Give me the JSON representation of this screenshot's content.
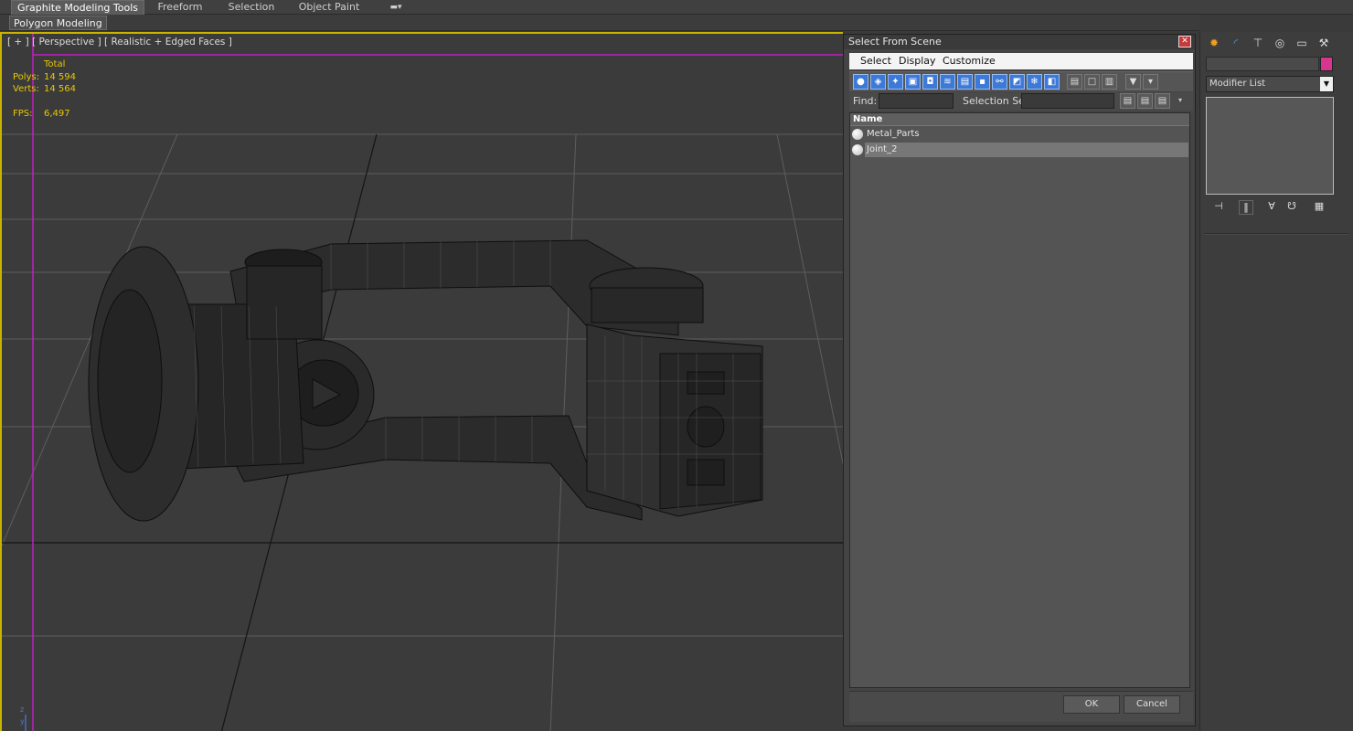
{
  "ribbon": {
    "tabs": [
      "Graphite Modeling Tools",
      "Freeform",
      "Selection",
      "Object Paint"
    ],
    "extra_icon": "ribbon-options-icon",
    "sub_panel": "Polygon Modeling"
  },
  "viewport": {
    "label": "[ + ] [ Perspective ] [ Realistic + Edged Faces ]",
    "stats": {
      "header": "Total",
      "polys_label": "Polys:",
      "polys": "14 594",
      "verts_label": "Verts:",
      "verts": "14 564",
      "fps_label": "FPS:",
      "fps": "6,497"
    },
    "axis_labels": [
      "z",
      "y"
    ]
  },
  "dialog": {
    "title": "Select From Scene",
    "menu": [
      "Select",
      "Display",
      "Customize"
    ],
    "find_label": "Find:",
    "find_value": "",
    "selection_set_label": "Selection Set:",
    "selection_set_value": "",
    "column_header": "Name",
    "items": [
      {
        "name": "Metal_Parts",
        "selected": false
      },
      {
        "name": "Joint_2",
        "selected": true
      }
    ],
    "ok": "OK",
    "cancel": "Cancel",
    "accent": "#3d7ad8"
  },
  "command_panel": {
    "tabs": [
      "create-icon",
      "modify-icon",
      "hierarchy-icon",
      "motion-icon",
      "display-icon",
      "utilities-icon"
    ],
    "object_name": "",
    "object_color": "#d8358f",
    "modifier_list": "Modifier List"
  }
}
